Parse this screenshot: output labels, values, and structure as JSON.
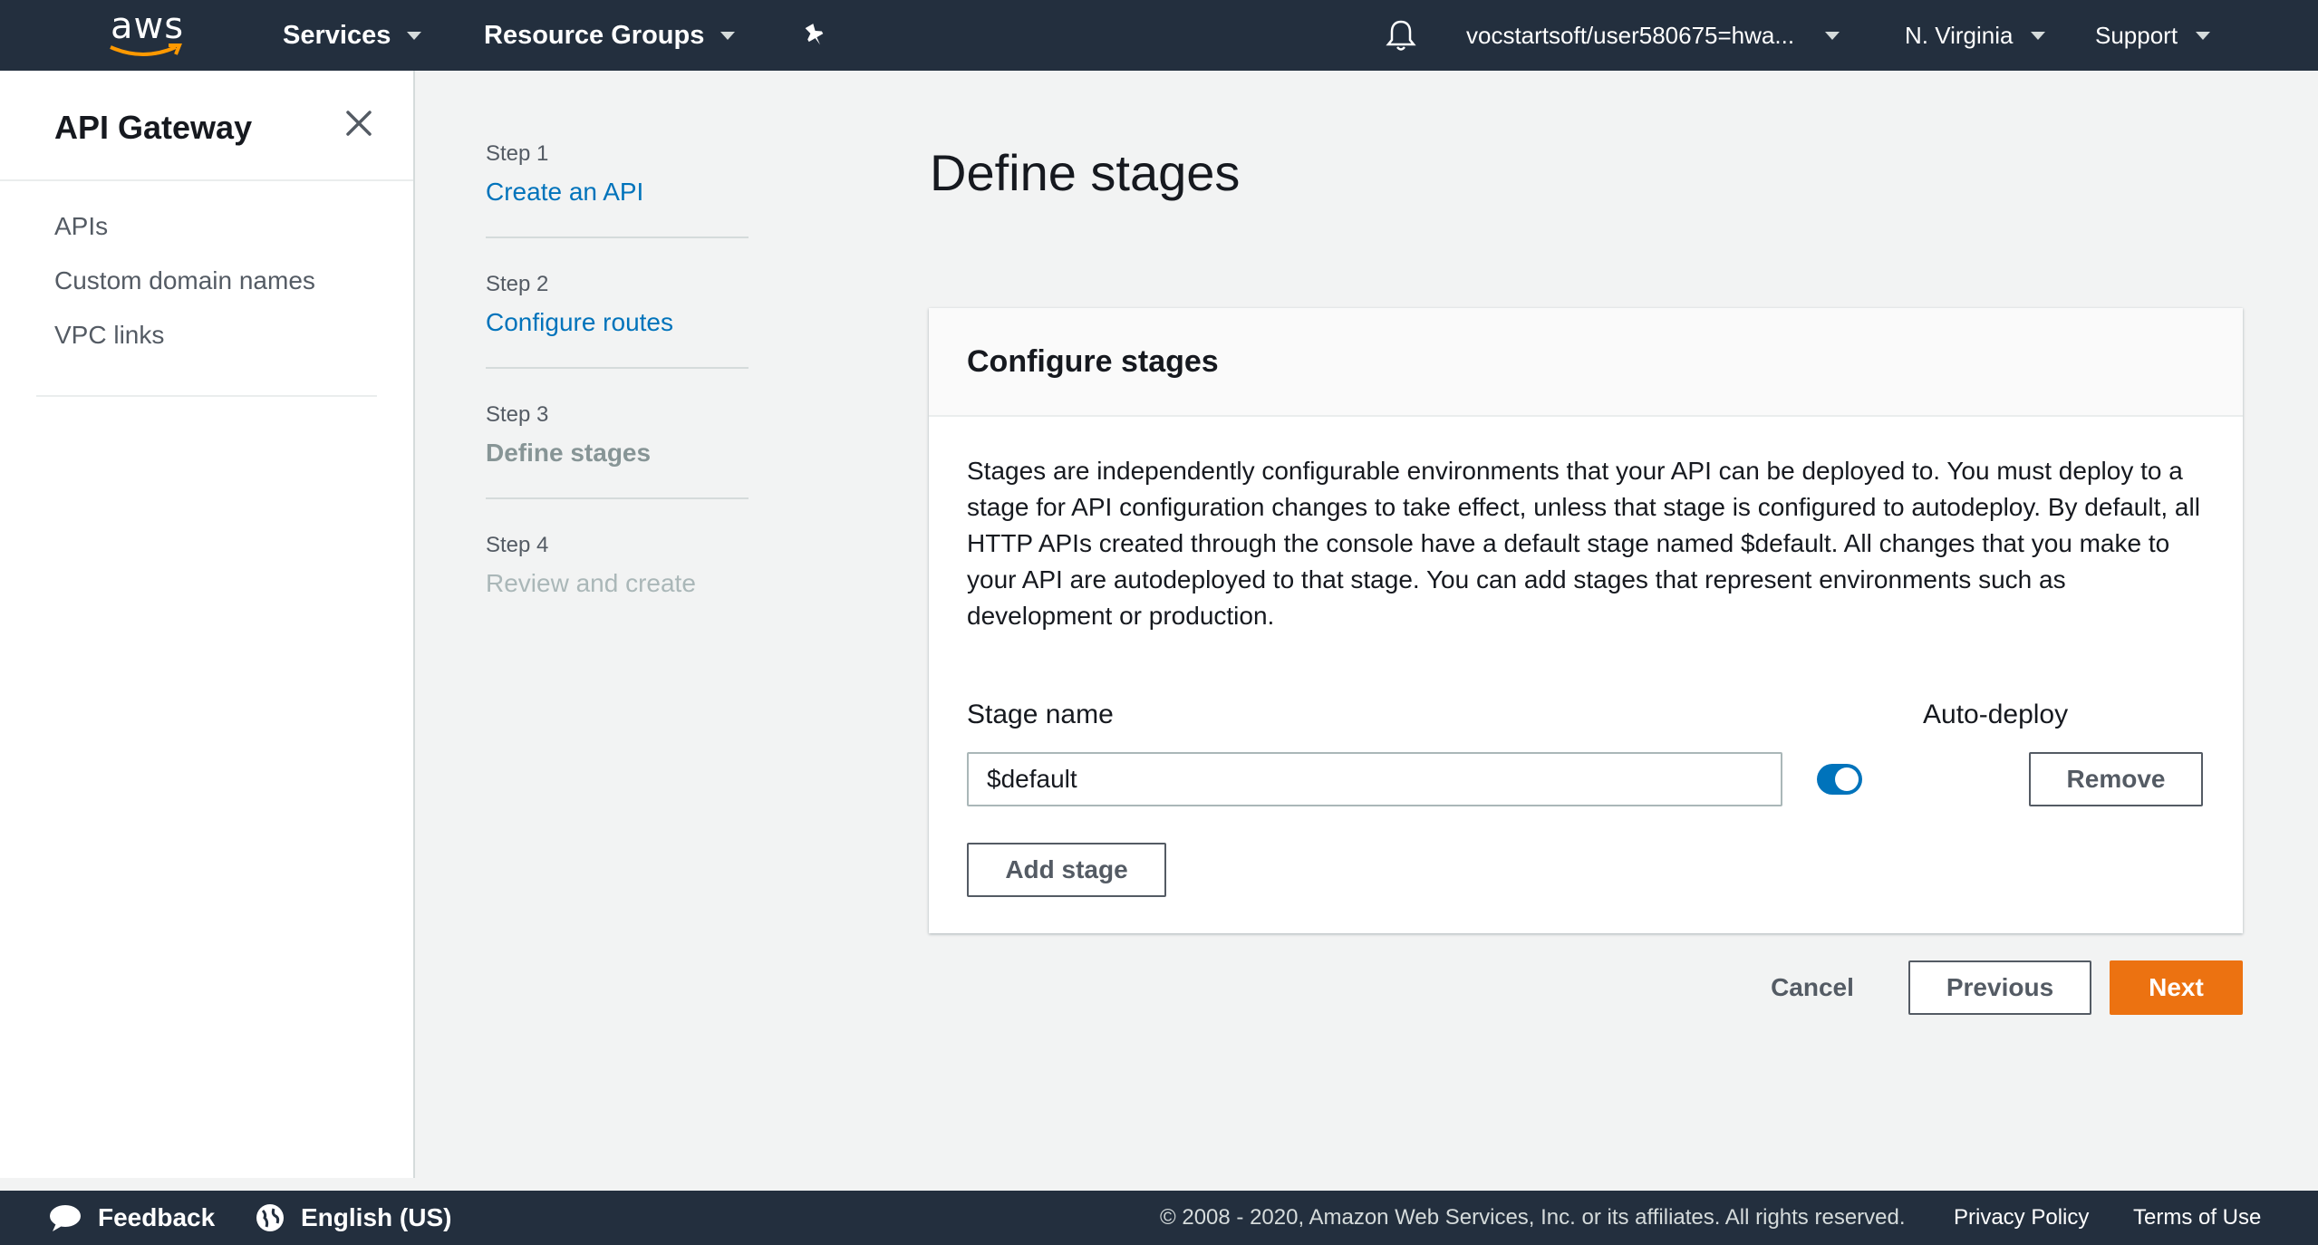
{
  "topnav": {
    "logo_text": "aws",
    "services_label": "Services",
    "resource_groups_label": "Resource Groups",
    "account_label": "vocstartsoft/user580675=hwa...",
    "region_label": "N. Virginia",
    "support_label": "Support"
  },
  "sidebar": {
    "title": "API Gateway",
    "items": [
      {
        "label": "APIs"
      },
      {
        "label": "Custom domain names"
      },
      {
        "label": "VPC links"
      }
    ]
  },
  "steps": [
    {
      "number": "Step 1",
      "label": "Create an API",
      "state": "link"
    },
    {
      "number": "Step 2",
      "label": "Configure routes",
      "state": "link"
    },
    {
      "number": "Step 3",
      "label": "Define stages",
      "state": "current"
    },
    {
      "number": "Step 4",
      "label": "Review and create",
      "state": "disabled"
    }
  ],
  "main": {
    "page_title": "Define stages",
    "panel_title": "Configure stages",
    "description": "Stages are independently configurable environments that your API can be deployed to. You must deploy to a stage for API configuration changes to take effect, unless that stage is configured to autodeploy. By default, all HTTP APIs created through the console have a default stage named $default. All changes that you make to your API are autodeployed to that stage. You can add stages that represent environments such as development or production.",
    "stage_name_label": "Stage name",
    "auto_deploy_label": "Auto-deploy",
    "stage_name_value": "$default",
    "auto_deploy_on": true,
    "remove_label": "Remove",
    "add_stage_label": "Add stage",
    "cancel_label": "Cancel",
    "previous_label": "Previous",
    "next_label": "Next"
  },
  "footer": {
    "feedback_label": "Feedback",
    "language_label": "English (US)",
    "copyright": "© 2008 - 2020, Amazon Web Services, Inc. or its affiliates. All rights reserved.",
    "privacy_label": "Privacy Policy",
    "terms_label": "Terms of Use"
  },
  "colors": {
    "nav_bg": "#232f3e",
    "link": "#0073bb",
    "primary": "#ec7211",
    "toggle_on": "#0073bb"
  }
}
